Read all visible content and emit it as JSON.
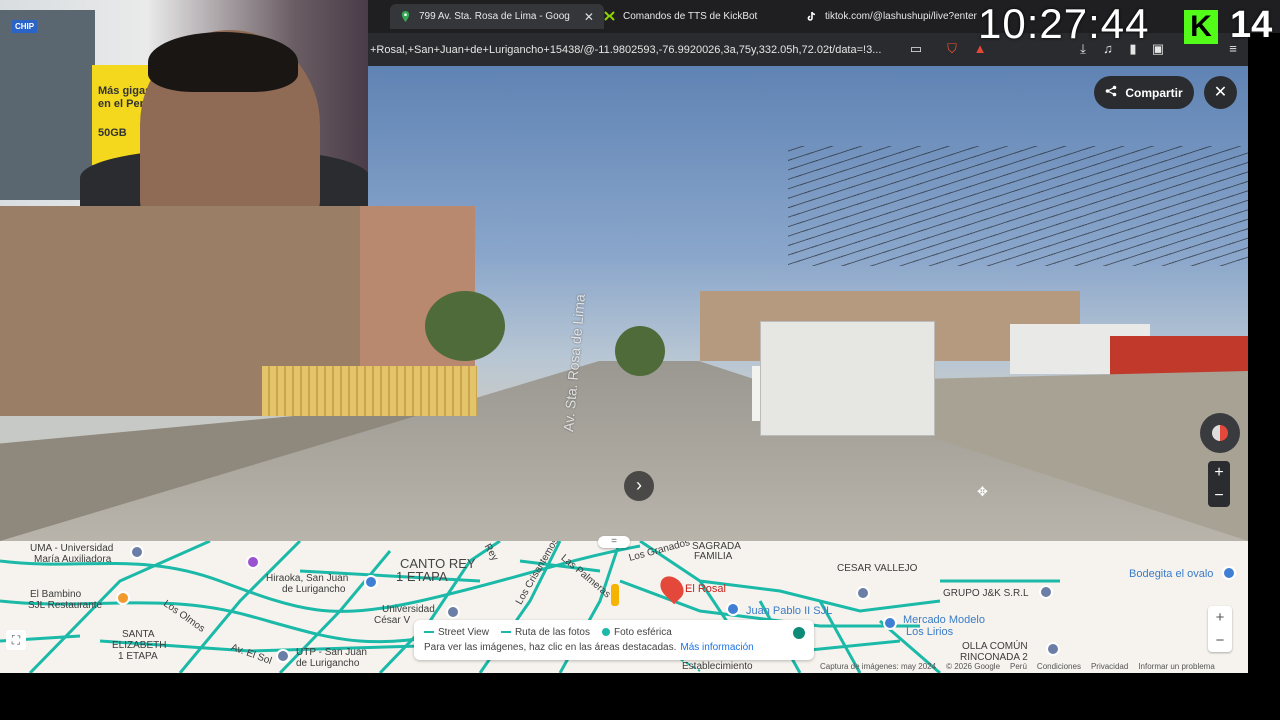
{
  "browser": {
    "tabs": [
      {
        "label": "799 Av. Sta. Rosa de Lima - Goog",
        "active": true
      },
      {
        "label": "Comandos de TTS de KickBot",
        "active": false
      },
      {
        "label": "tiktok.com/@lashushupi/live?enter",
        "active": false
      }
    ],
    "tab_close": "✕",
    "url": "+Rosal,+San+Juan+de+Lurigancho+15438/@-11.9802593,-76.9920026,3a,75y,332.05h,72.02t/data=!3..."
  },
  "overlay": {
    "clock": "10:27:44",
    "kick_logo": "K",
    "count": "14"
  },
  "webcam_poster": {
    "line1": "Más gigas",
    "line2": "en el Perú",
    "gb": "50GB",
    "brand": "CHIP"
  },
  "streetview": {
    "share_label": "Compartir",
    "close_label": "✕",
    "road_label": "Av. Sta. Rosa de Lima",
    "nav_arrow": "›",
    "zoom_in": "+",
    "zoom_out": "−"
  },
  "map": {
    "labels": {
      "uma": "UMA - Universidad",
      "uma2": "María Auxiliadora",
      "bambino": "El Bambino",
      "bambino2": "SJL Restaurante",
      "hiraoka": "Hiraoka, San Juan",
      "hiraoka2": "de Lurigancho",
      "canto_rey": "CANTO REY",
      "canto_rey2": "1 ETAPA",
      "universidad": "Universidad",
      "universidad2": "César V",
      "santa": "SANTA",
      "santa2": "ELIZABETH",
      "santa3": "1 ETAPA",
      "utp": "UTP - San Juan",
      "utp2": "de Lurigancho",
      "los_olmos": "Los Olmos",
      "el_sol": "Av. El Sol",
      "granados": "Los Granados",
      "palmeras": "Las Palmeras",
      "crisantemos": "Los Crisantemos",
      "rey": "Rey",
      "sagrada": "SAGRADA",
      "familia": "FAMILIA",
      "el_rosal": "El Rosal",
      "juan_pablo": "Juan Pablo II SJL",
      "cesar_vallejo": "CESAR VALLEJO",
      "grupo": "GRUPO J&K S.R.L",
      "bodeguita": "Bodegita el ovalo",
      "mercado": "Mercado Modelo",
      "mercado2": "Los Lirios",
      "olla": "OLLA COMÚN",
      "olla2": "RINCONADA 2",
      "establecimiento": "Establecimiento"
    },
    "legend": {
      "street_view": "Street View",
      "photo_route": "Ruta de las fotos",
      "spherical": "Foto esférica",
      "hint": "Para ver las imágenes, haz clic en las áreas destacadas.",
      "more": "Más información"
    },
    "zoom_in": "+",
    "zoom_out": "−",
    "fullscreen": "⛶",
    "drag_handle": "=",
    "attribution": {
      "capture": "Captura de imágenes: may 2024",
      "copyright": "© 2026 Google",
      "country": "Perú",
      "terms": "Condiciones",
      "privacy": "Privacidad",
      "report": "Informar un problema"
    }
  },
  "colors": {
    "streetview_line": "#1bb9a8",
    "kick_green": "#53fc18",
    "pin_red": "#e3483b"
  }
}
